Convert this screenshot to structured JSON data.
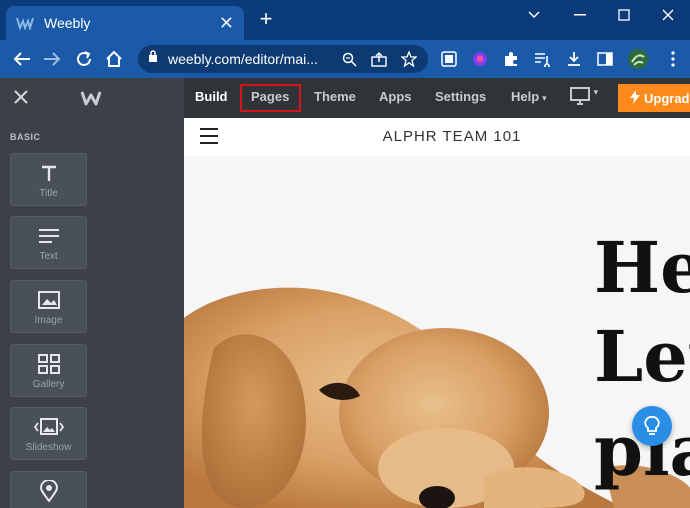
{
  "browser": {
    "tab_title": "Weebly",
    "url": "weebly.com/editor/mai...",
    "new_tab": "+"
  },
  "editor": {
    "nav": [
      "Build",
      "Pages",
      "Theme",
      "Apps",
      "Settings",
      "Help"
    ],
    "active_nav": "Build",
    "highlighted_nav": "Pages",
    "upgrade_label": "Upgrad"
  },
  "sidebar": {
    "section": "BASIC",
    "tiles": [
      {
        "label": "Title",
        "icon": "title-icon"
      },
      {
        "label": "Text",
        "icon": "text-icon"
      },
      {
        "label": "Image",
        "icon": "image-icon"
      },
      {
        "label": "Gallery",
        "icon": "gallery-icon"
      },
      {
        "label": "Slideshow",
        "icon": "slideshow-icon"
      },
      {
        "label": "",
        "icon": "map-pin-icon"
      }
    ]
  },
  "site": {
    "title": "ALPHR TEAM 101",
    "hero_lines": [
      "Hey",
      "Let",
      "pla"
    ]
  },
  "colors": {
    "chrome": "#1a5aa8",
    "editor_bar": "#3b4147",
    "upgrade": "#ff8a1c",
    "highlight": "#d8141b",
    "help_bubble": "#2b8ee6"
  }
}
